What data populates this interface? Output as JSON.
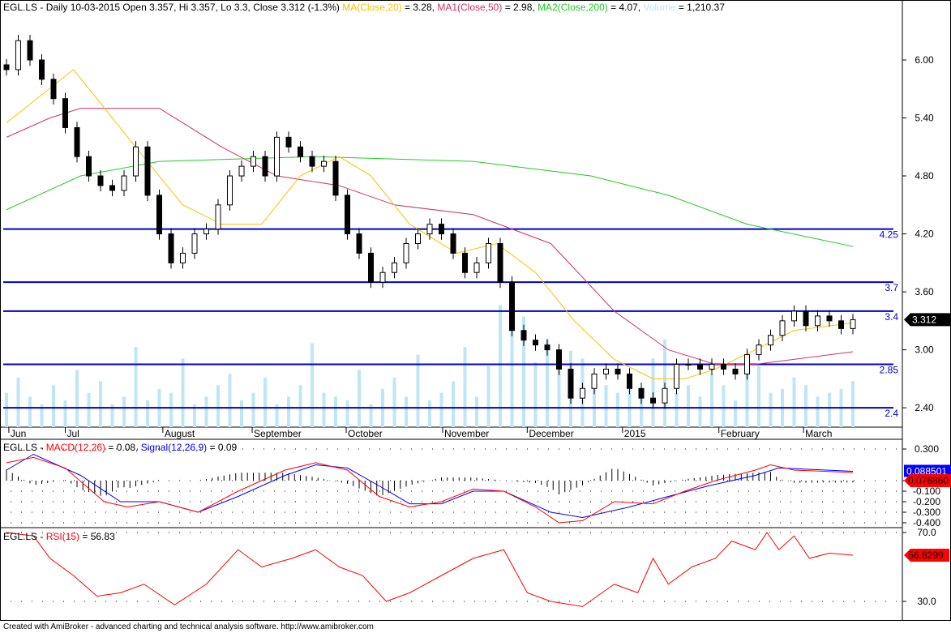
{
  "header": {
    "symbol": "EGL.LS",
    "text": "EGL.LS - Daily 10-03-2015 Open 3.357, Hi 3.357, Lo 3.3, Close 3.312 (-1.3%)",
    "ma_label": "MA(Close,20)",
    "ma_value": " = 3.28, ",
    "ma1_label": "MA1(Close,50)",
    "ma1_value": " = 2.98, ",
    "ma2_label": "MA2(Close,200)",
    "ma2_value": " = 4.07, ",
    "vol_label": "Volume",
    "vol_value": " = 1,210.37"
  },
  "macd_header": {
    "prefix": "EGL.LS - ",
    "macd_label": "MACD(12,26)",
    "macd_value": " = 0.08, ",
    "signal_label": "Signal(12,26,9)",
    "signal_value": " = 0.09"
  },
  "rsi_header": {
    "prefix": "EGL.LS - ",
    "rsi_label": "RSI(15)",
    "rsi_value": " = 56.83"
  },
  "footer": "Created with AmiBroker - advanced charting and technical analysis software. http://www.amibroker.com",
  "colors": {
    "ma20": "#f5c400",
    "ma50": "#d0306a",
    "ma200": "#22cc22",
    "volume": "#bfe6f5",
    "level": "#0000cc",
    "macd": "#ff0000",
    "signal": "#0000ff"
  },
  "chart_data": [
    {
      "type": "candlestick",
      "title": "EGL.LS Daily",
      "ylim": [
        2.3,
        6.4
      ],
      "y_ticks": [
        "6.00",
        "5.40",
        "4.80",
        "4.20",
        "3.60",
        "3.00",
        "2.40"
      ],
      "x_ticks": [
        {
          "label": "Jun",
          "bar": 0.2
        },
        {
          "label": "Jul",
          "bar": 5
        },
        {
          "label": "August",
          "bar": 13.3
        },
        {
          "label": "September",
          "bar": 20.9
        },
        {
          "label": "October",
          "bar": 28.9
        },
        {
          "label": "November",
          "bar": 37.1
        },
        {
          "label": "December",
          "bar": 44.3
        },
        {
          "label": "2015",
          "bar": 52.4
        },
        {
          "label": "February",
          "bar": 60.6
        },
        {
          "label": "March",
          "bar": 67.8
        }
      ],
      "close": [
        5.9,
        6.2,
        6.0,
        5.8,
        5.6,
        5.3,
        5.0,
        4.8,
        4.7,
        4.65,
        4.8,
        5.1,
        4.6,
        4.2,
        3.9,
        4.0,
        4.2,
        4.25,
        4.5,
        4.8,
        4.9,
        5.0,
        4.8,
        5.2,
        5.1,
        5.0,
        4.9,
        4.95,
        4.6,
        4.2,
        4.0,
        3.7,
        3.8,
        3.9,
        4.1,
        4.2,
        4.3,
        4.2,
        4.0,
        3.8,
        3.9,
        4.1,
        3.7,
        3.2,
        3.1,
        3.05,
        3.0,
        2.8,
        2.5,
        2.6,
        2.75,
        2.8,
        2.75,
        2.6,
        2.5,
        2.45,
        2.6,
        2.85,
        2.85,
        2.8,
        2.85,
        2.8,
        2.75,
        2.95,
        3.05,
        3.15,
        3.3,
        3.4,
        3.25,
        3.35,
        3.3,
        3.22,
        3.312
      ],
      "volume": [
        900,
        1300,
        800,
        600,
        1100,
        700,
        1500,
        900,
        1200,
        600,
        800,
        2100,
        700,
        1000,
        900,
        1800,
        600,
        800,
        1100,
        1400,
        700,
        900,
        1300,
        600,
        800,
        1100,
        2200,
        900,
        800,
        700,
        1500,
        600,
        1000,
        1300,
        800,
        1900,
        700,
        900,
        1200,
        2100,
        800,
        1600,
        3200,
        2500,
        2900,
        1700,
        2300,
        1500,
        2000,
        1800,
        1400,
        1100,
        900,
        1300,
        1000,
        1800,
        2300,
        900,
        1100,
        800,
        1400,
        1100,
        700,
        1500,
        1600,
        900,
        1000,
        1300,
        1100,
        800,
        900,
        1000,
        1210
      ],
      "ma20": [
        [
          0,
          5.35
        ],
        [
          5.7,
          5.9
        ],
        [
          12.3,
          4.9
        ],
        [
          15,
          4.5
        ],
        [
          18.3,
          4.3
        ],
        [
          21.7,
          4.3
        ],
        [
          25,
          4.8
        ],
        [
          28.3,
          5.0
        ],
        [
          31,
          4.8
        ],
        [
          34.3,
          4.3
        ],
        [
          38.3,
          4.0
        ],
        [
          41.7,
          4.1
        ],
        [
          45,
          3.8
        ],
        [
          48.3,
          3.3
        ],
        [
          51.7,
          2.9
        ],
        [
          55,
          2.7
        ],
        [
          57.7,
          2.7
        ],
        [
          60.3,
          2.8
        ],
        [
          63.7,
          3.0
        ],
        [
          67,
          3.2
        ],
        [
          72,
          3.28
        ]
      ],
      "ma50": [
        [
          0,
          5.2
        ],
        [
          3.7,
          5.4
        ],
        [
          6.3,
          5.5
        ],
        [
          13,
          5.5
        ],
        [
          18.3,
          5.1
        ],
        [
          23,
          4.8
        ],
        [
          28.3,
          4.7
        ],
        [
          33,
          4.5
        ],
        [
          39.7,
          4.4
        ],
        [
          46.3,
          4.1
        ],
        [
          51.7,
          3.4
        ],
        [
          56.3,
          3.0
        ],
        [
          60.3,
          2.85
        ],
        [
          63.7,
          2.85
        ],
        [
          72,
          2.98
        ]
      ],
      "ma200": [
        [
          0,
          4.45
        ],
        [
          6.3,
          4.8
        ],
        [
          13,
          4.95
        ],
        [
          26.3,
          5.0
        ],
        [
          39.7,
          4.95
        ],
        [
          49.7,
          4.8
        ],
        [
          56.3,
          4.6
        ],
        [
          63,
          4.3
        ],
        [
          72,
          4.07
        ]
      ],
      "levels": [
        {
          "value": 4.25,
          "label": "4.25"
        },
        {
          "value": 3.7,
          "label": "3.7"
        },
        {
          "value": 3.4,
          "label": "3.4"
        },
        {
          "value": 2.85,
          "label": "2.85"
        },
        {
          "value": 2.4,
          "label": "2.4"
        }
      ],
      "last_price_label": "3.312"
    },
    {
      "type": "line",
      "title": "MACD",
      "ylim": [
        -0.45,
        0.35
      ],
      "y_ticks": [
        "0.300",
        "0.000",
        "-0.100",
        "-0.200",
        "-0.300",
        "-0.400"
      ],
      "macd": [
        [
          0,
          0.17
        ],
        [
          2.3,
          0.22
        ],
        [
          5,
          0.12
        ],
        [
          8.3,
          -0.2
        ],
        [
          10.3,
          -0.25
        ],
        [
          13,
          -0.2
        ],
        [
          16.3,
          -0.3
        ],
        [
          19.7,
          -0.1
        ],
        [
          23.7,
          0.1
        ],
        [
          26.3,
          0.17
        ],
        [
          29,
          0.1
        ],
        [
          31.7,
          -0.15
        ],
        [
          34.3,
          -0.25
        ],
        [
          37,
          -0.2
        ],
        [
          39.7,
          -0.08
        ],
        [
          42.3,
          -0.1
        ],
        [
          45,
          -0.25
        ],
        [
          47,
          -0.4
        ],
        [
          49,
          -0.38
        ],
        [
          51.7,
          -0.2
        ],
        [
          55,
          -0.22
        ],
        [
          57.7,
          -0.1
        ],
        [
          60.3,
          0.0
        ],
        [
          63.7,
          0.1
        ],
        [
          65,
          0.15
        ],
        [
          67,
          0.1
        ],
        [
          72,
          0.077
        ]
      ],
      "signal": [
        [
          0,
          0.1
        ],
        [
          2.3,
          0.25
        ],
        [
          6.3,
          0.05
        ],
        [
          9.7,
          -0.2
        ],
        [
          13,
          -0.2
        ],
        [
          16.3,
          -0.3
        ],
        [
          19.7,
          -0.15
        ],
        [
          23.7,
          0.05
        ],
        [
          26.3,
          0.15
        ],
        [
          29,
          0.12
        ],
        [
          31.7,
          -0.05
        ],
        [
          34.3,
          -0.22
        ],
        [
          37,
          -0.22
        ],
        [
          39.7,
          -0.1
        ],
        [
          42.3,
          -0.1
        ],
        [
          46.3,
          -0.3
        ],
        [
          49,
          -0.35
        ],
        [
          53,
          -0.25
        ],
        [
          56.3,
          -0.15
        ],
        [
          59.7,
          -0.05
        ],
        [
          63.7,
          0.05
        ],
        [
          65.7,
          0.12
        ],
        [
          72,
          0.0885
        ]
      ],
      "signal_last_label": "0.088501",
      "macd_last_label": "0.076860"
    },
    {
      "type": "line",
      "title": "RSI(15)",
      "ylim": [
        20,
        75
      ],
      "y_ticks": [
        "70.0",
        "30.0"
      ],
      "rsi": [
        [
          0,
          70
        ],
        [
          2.3,
          68
        ],
        [
          3.7,
          55
        ],
        [
          5.7,
          45
        ],
        [
          7.7,
          33
        ],
        [
          9.7,
          35
        ],
        [
          11.7,
          40
        ],
        [
          14.3,
          28
        ],
        [
          17,
          40
        ],
        [
          19.7,
          60
        ],
        [
          21.7,
          50
        ],
        [
          24.3,
          55
        ],
        [
          26.3,
          60
        ],
        [
          28.3,
          50
        ],
        [
          30.3,
          45
        ],
        [
          32.3,
          30
        ],
        [
          34.3,
          35
        ],
        [
          37,
          45
        ],
        [
          39.7,
          55
        ],
        [
          42.3,
          60
        ],
        [
          44.3,
          35
        ],
        [
          46.3,
          30
        ],
        [
          49,
          27
        ],
        [
          51.7,
          40
        ],
        [
          53.7,
          35
        ],
        [
          55,
          55
        ],
        [
          56.3,
          40
        ],
        [
          58.3,
          50
        ],
        [
          60.3,
          55
        ],
        [
          61.7,
          65
        ],
        [
          63.7,
          60
        ],
        [
          64.7,
          70
        ],
        [
          65.7,
          60
        ],
        [
          67,
          68
        ],
        [
          68.3,
          55
        ],
        [
          70,
          58
        ],
        [
          72,
          56.8
        ]
      ],
      "last_label": "56.8299"
    }
  ]
}
